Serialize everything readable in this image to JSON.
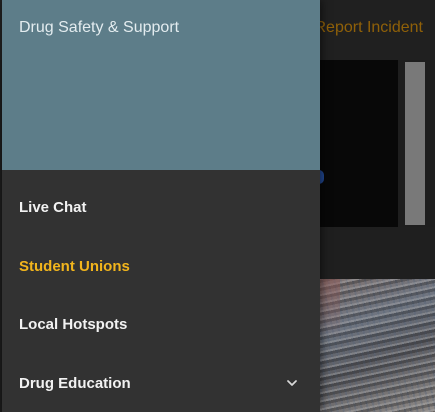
{
  "app_bar": {
    "report_label": "Report Incident"
  },
  "drawer": {
    "title": "Drug Safety & Support",
    "items": [
      {
        "label": "Live Chat",
        "active": false
      },
      {
        "label": "Student Unions",
        "active": true
      },
      {
        "label": "Local Hotspots",
        "active": false
      },
      {
        "label": "Drug Education",
        "active": false,
        "expandable": true
      }
    ]
  },
  "colors": {
    "accent": "#f2b51c",
    "header": "#5d7d89",
    "drawer_bg": "#323232",
    "report_link": "#c7860c"
  },
  "icons": {
    "drug_education": "chevron-down-icon"
  }
}
